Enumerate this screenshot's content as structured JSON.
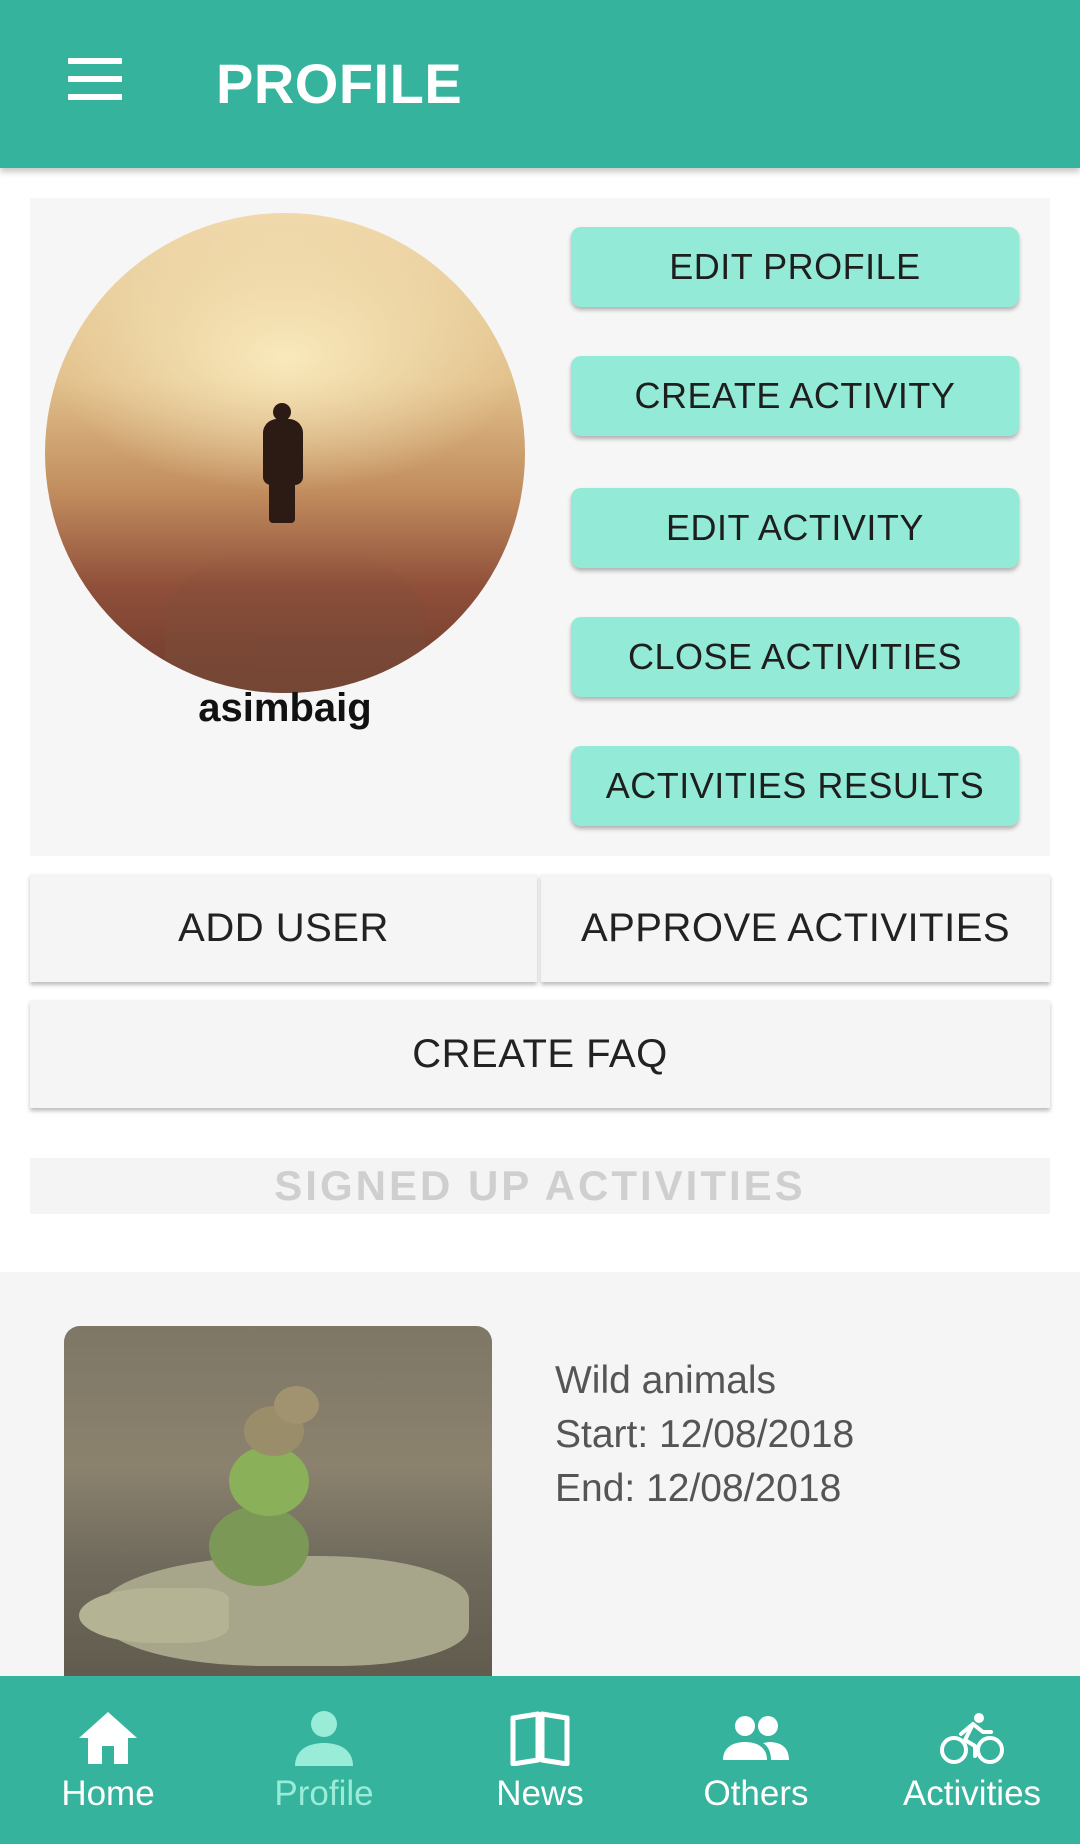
{
  "header": {
    "title": "PROFILE",
    "menu_icon": "hamburger-menu-icon"
  },
  "profile": {
    "username": "asimbaig",
    "actions": [
      "EDIT PROFILE",
      "CREATE ACTIVITY",
      "EDIT ACTIVITY",
      "CLOSE ACTIVITIES",
      "ACTIVITIES RESULTS"
    ]
  },
  "admin": {
    "add_user": "ADD USER",
    "approve_activities": "APPROVE ACTIVITIES",
    "create_faq": "CREATE FAQ"
  },
  "signed_up": {
    "header": "SIGNED UP ACTIVITIES",
    "items": [
      {
        "name": "Wild animals",
        "start": "Start: 12/08/2018",
        "end": "End: 12/08/2018"
      }
    ]
  },
  "bottom_nav": [
    {
      "label": "Home",
      "icon": "home-icon",
      "active": false
    },
    {
      "label": "Profile",
      "icon": "person-icon",
      "active": true
    },
    {
      "label": "News",
      "icon": "book-icon",
      "active": false
    },
    {
      "label": "Others",
      "icon": "people-icon",
      "active": false
    },
    {
      "label": "Activities",
      "icon": "bike-icon",
      "active": false
    }
  ],
  "colors": {
    "primary": "#36b39c",
    "action_button": "#93ead6",
    "active_nav": "#98ecd8",
    "section_header_text": "#cfcfcf"
  }
}
